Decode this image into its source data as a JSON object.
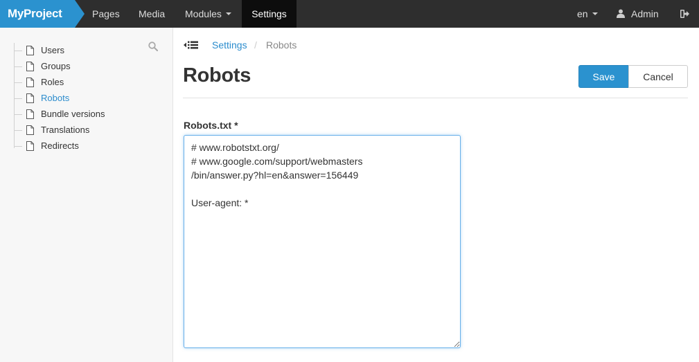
{
  "app": {
    "brand": "MyProject",
    "nav": [
      {
        "label": "Pages"
      },
      {
        "label": "Media"
      },
      {
        "label": "Modules"
      },
      {
        "label": "Settings",
        "active": true
      }
    ],
    "language": "en",
    "user": "Admin"
  },
  "sidebar": {
    "items": [
      {
        "label": "Users"
      },
      {
        "label": "Groups"
      },
      {
        "label": "Roles"
      },
      {
        "label": "Robots",
        "active": true
      },
      {
        "label": "Bundle versions"
      },
      {
        "label": "Translations"
      },
      {
        "label": "Redirects"
      }
    ]
  },
  "breadcrumb": {
    "parent": "Settings",
    "separator": "/",
    "current": "Robots"
  },
  "page": {
    "title": "Robots",
    "save_label": "Save",
    "cancel_label": "Cancel"
  },
  "form": {
    "field_label": "Robots.txt *",
    "value": "# www.robotstxt.org/\n# www.google.com/support/webmasters\n/bin/answer.py?hl=en&answer=156449\n\nUser-agent: *"
  },
  "colors": {
    "brand": "#2b92cf",
    "navbar": "#2e2e2e",
    "link": "#2b8ccd"
  }
}
